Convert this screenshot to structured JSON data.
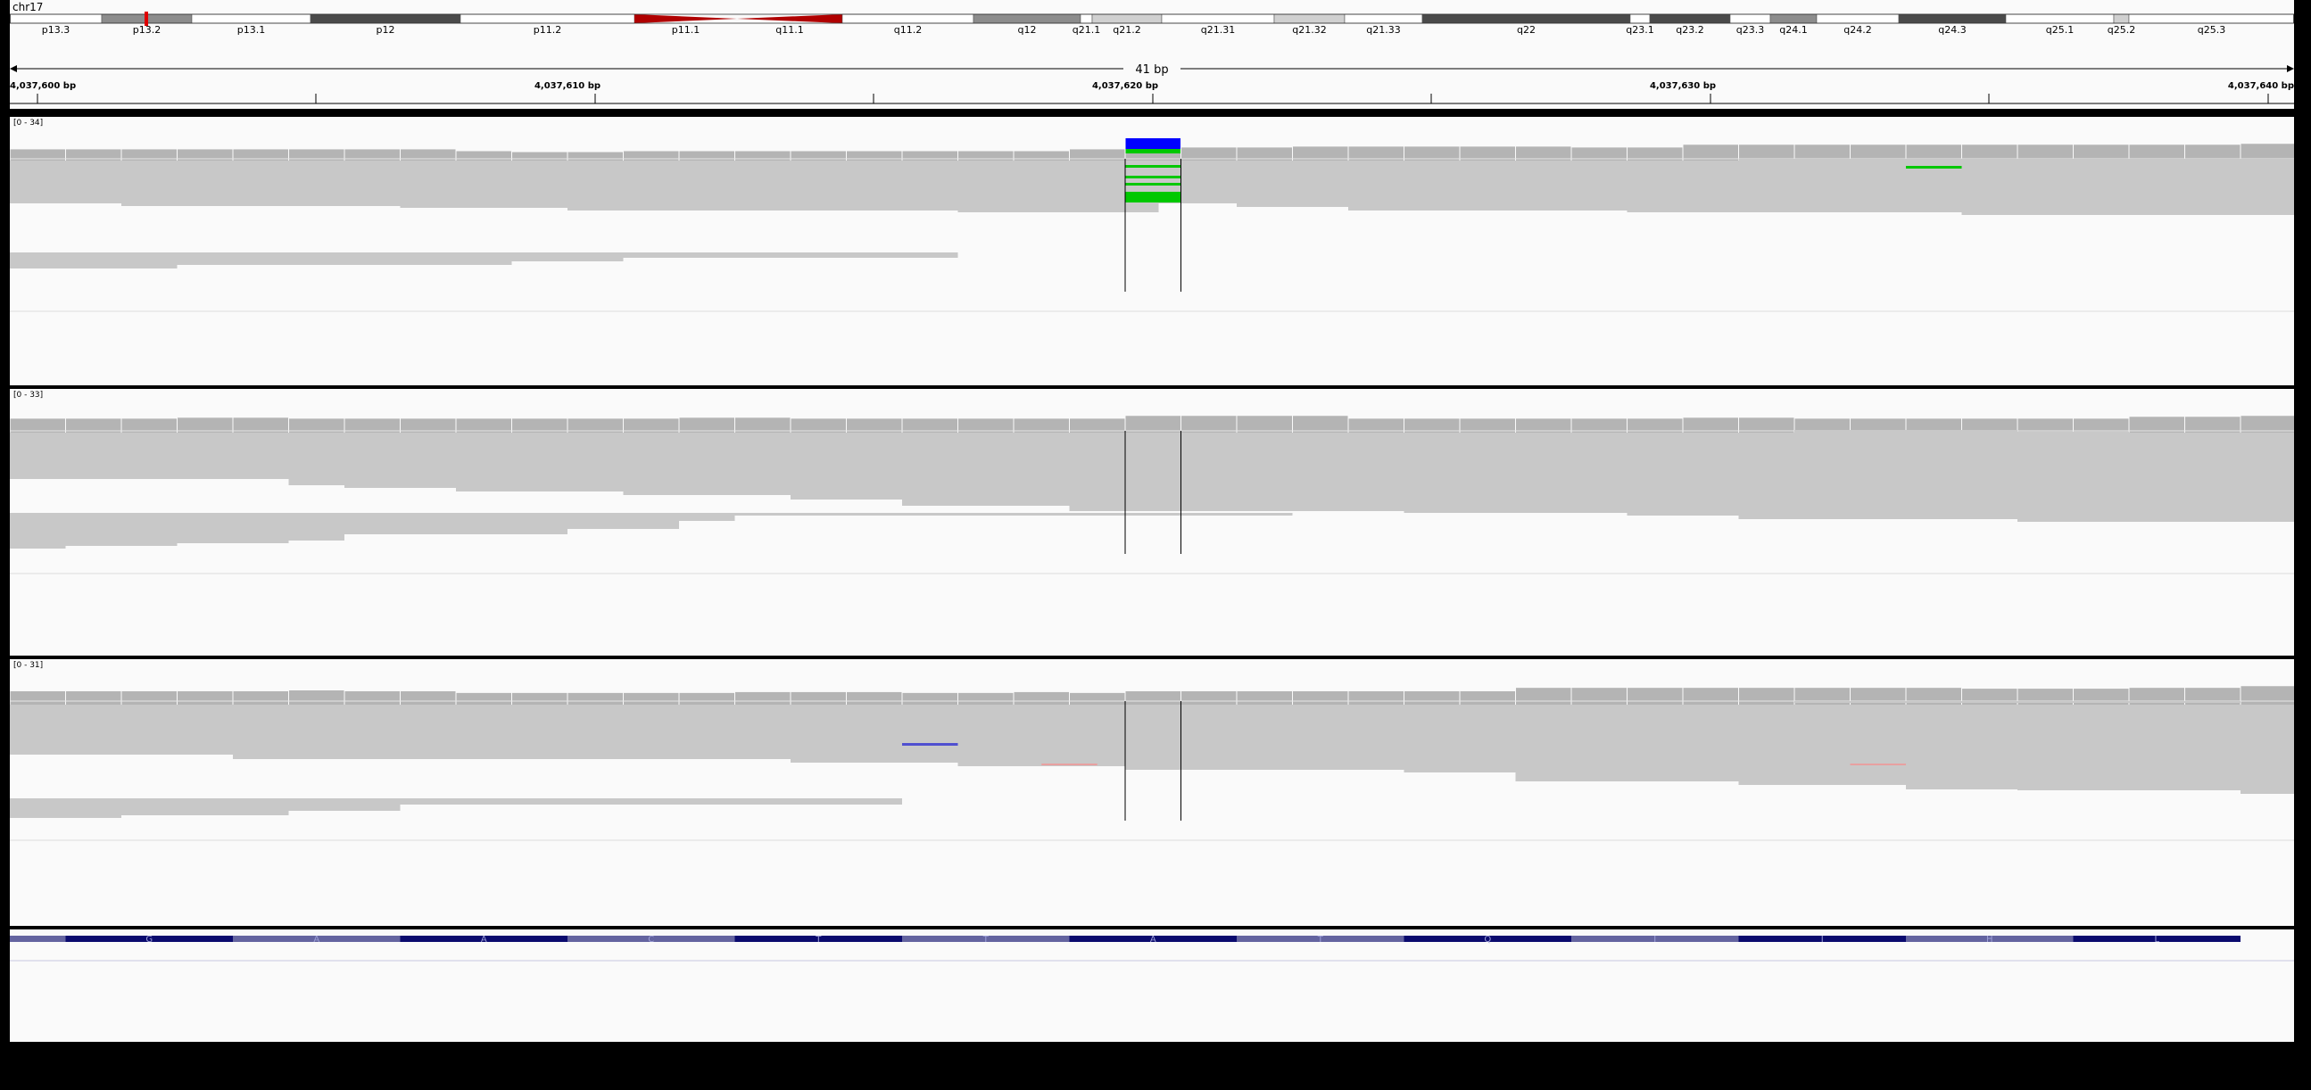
{
  "chromosome": {
    "name": "chr17"
  },
  "ideogram": {
    "bands": [
      {
        "label": "p13.3",
        "stain": "gneg"
      },
      {
        "label": "p13.2",
        "stain": "gpos50"
      },
      {
        "label": "p13.1",
        "stain": "gneg"
      },
      {
        "label": "p12",
        "stain": "gpos75"
      },
      {
        "label": "p11.2",
        "stain": "gneg"
      },
      {
        "label": "p11.1",
        "stain": "acen"
      },
      {
        "label": "q11.1",
        "stain": "acen"
      },
      {
        "label": "q11.2",
        "stain": "gneg"
      },
      {
        "label": "q12",
        "stain": "gpos50"
      },
      {
        "label": "q21.1",
        "stain": "gneg"
      },
      {
        "label": "q21.2",
        "stain": "gpos25"
      },
      {
        "label": "q21.31",
        "stain": "gneg"
      },
      {
        "label": "q21.32",
        "stain": "gpos25"
      },
      {
        "label": "q21.33",
        "stain": "gneg"
      },
      {
        "label": "q22",
        "stain": "gpos75"
      },
      {
        "label": "q23.1",
        "stain": "gneg"
      },
      {
        "label": "q23.2",
        "stain": "gpos75"
      },
      {
        "label": "q23.3",
        "stain": "gneg"
      },
      {
        "label": "q24.1",
        "stain": "gpos50"
      },
      {
        "label": "q24.2",
        "stain": "gneg"
      },
      {
        "label": "q24.3",
        "stain": "gpos75"
      },
      {
        "label": "q25.1",
        "stain": "gneg"
      },
      {
        "label": "q25.2",
        "stain": "gpos25"
      },
      {
        "label": "q25.3",
        "stain": "gneg"
      }
    ],
    "current_locus_color": "#e00000"
  },
  "ruler": {
    "span_label": "41 bp",
    "ticks": [
      "4,037,600 bp",
      "4,037,610 bp",
      "4,037,620 bp",
      "4,037,630 bp",
      "4,037,640 bp"
    ]
  },
  "tracks": [
    {
      "range_label": "[0 - 34]"
    },
    {
      "range_label": "[0 - 33]"
    },
    {
      "range_label": "[0 - 31]"
    }
  ],
  "sequence": {
    "amino_acids": [
      "G",
      "A",
      "A",
      "C",
      "T",
      "T",
      "A",
      "T",
      "Q",
      "I",
      "I",
      "H",
      "L"
    ]
  },
  "colors": {
    "coverage": "#b4b4b4",
    "read": "#c8c8c8",
    "mismatch_C": "#00c800",
    "mismatch_G": "#0000ff",
    "accent_blue": "#5050d0",
    "faint_red": "#e8a0a0",
    "panel_bg": "#fafafa",
    "amino_dark": "#0a0a6e",
    "amino_light": "#6464a0"
  }
}
